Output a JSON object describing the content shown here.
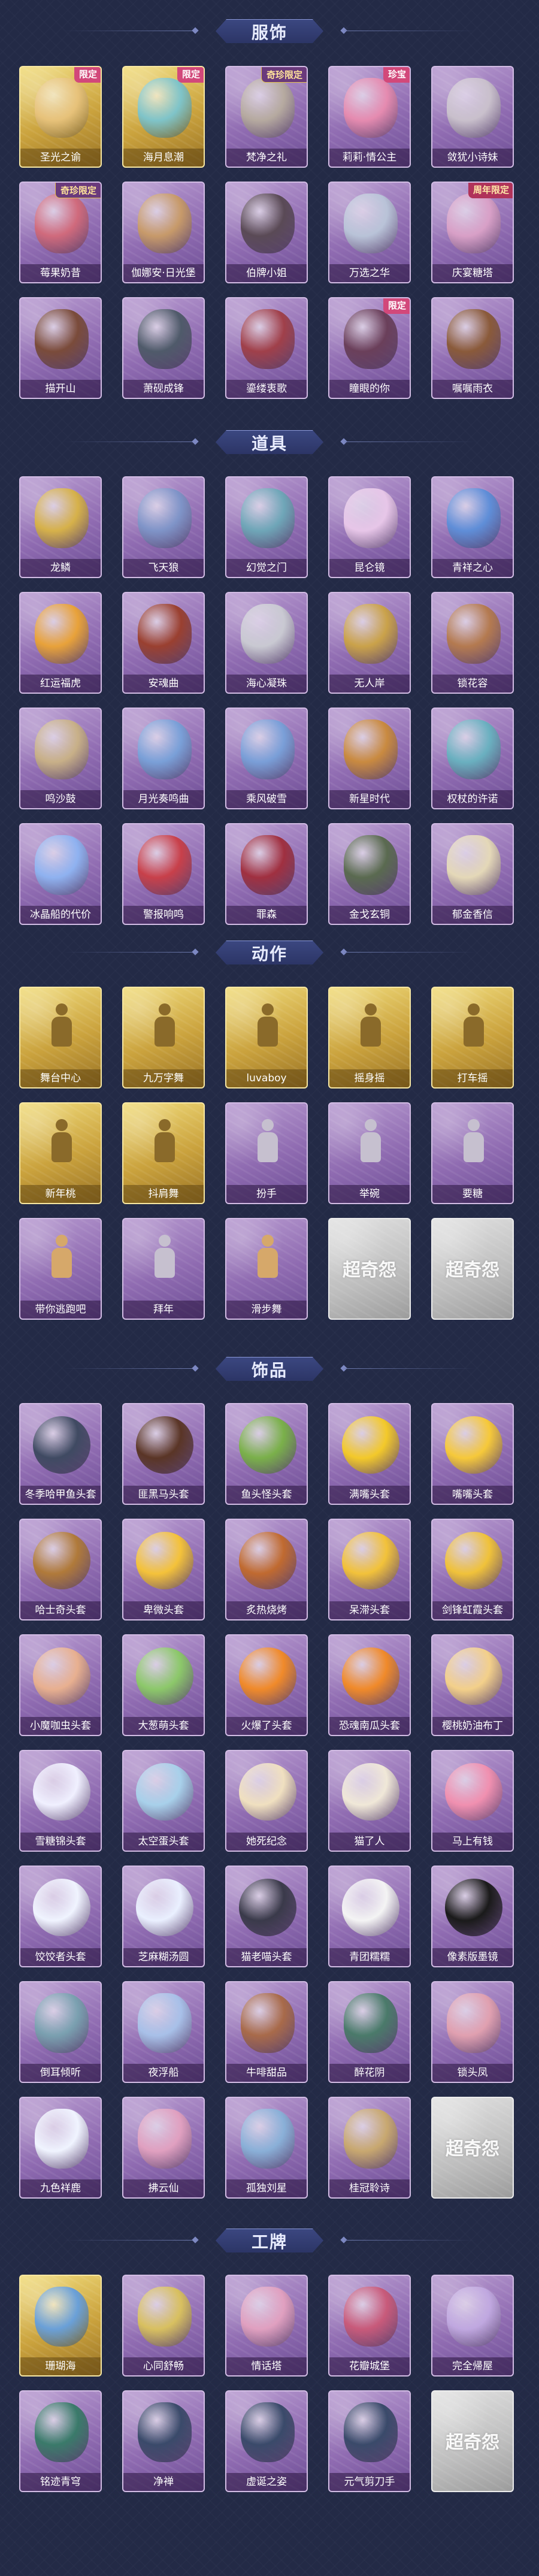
{
  "sections": [
    {
      "title": "服饰",
      "items": [
        {
          "label": "圣光之谕",
          "tag": "限定",
          "tag_type": "limited",
          "style": "gold",
          "icon": "costume-portrait-icon",
          "color": "#e7c27a"
        },
        {
          "label": "海月息潮",
          "tag": "限定",
          "tag_type": "limited",
          "style": "gold",
          "icon": "costume-portrait-icon",
          "color": "#7fc4c9"
        },
        {
          "label": "梵净之礼",
          "tag": "奇珍限定",
          "tag_type": "mystery",
          "style": "purple",
          "icon": "costume-portrait-icon",
          "color": "#b6aaa0"
        },
        {
          "label": "莉莉·情公主",
          "tag": "珍宝",
          "tag_type": "limited",
          "style": "purple",
          "icon": "costume-portrait-icon",
          "color": "#e58bb0"
        },
        {
          "label": "敛犹小诗妹",
          "tag": "",
          "tag_type": "",
          "style": "purple",
          "icon": "costume-portrait-icon",
          "color": "#c9c0cc"
        },
        {
          "label": "莓果奶昔",
          "tag": "奇珍限定",
          "tag_type": "mystery",
          "style": "purple",
          "icon": "costume-portrait-icon",
          "color": "#d06a7c"
        },
        {
          "label": "伽娜安·日光堡",
          "tag": "",
          "tag_type": "",
          "style": "purple",
          "icon": "costume-portrait-icon",
          "color": "#c79a6a"
        },
        {
          "label": "伯牌小姐",
          "tag": "",
          "tag_type": "",
          "style": "purple",
          "icon": "costume-portrait-icon",
          "color": "#5a4a56"
        },
        {
          "label": "万选之华",
          "tag": "",
          "tag_type": "",
          "style": "purple",
          "icon": "costume-portrait-icon",
          "color": "#b9c3d8"
        },
        {
          "label": "庆宴糖塔",
          "tag": "周年限定",
          "tag_type": "anniv",
          "style": "purple",
          "icon": "costume-portrait-icon",
          "color": "#d8a0c7"
        },
        {
          "label": "描开山",
          "tag": "",
          "tag_type": "",
          "style": "purple",
          "icon": "costume-portrait-icon",
          "color": "#7a4b3a"
        },
        {
          "label": "萧砚成锋",
          "tag": "",
          "tag_type": "",
          "style": "purple",
          "icon": "costume-portrait-icon",
          "color": "#4f5a6a"
        },
        {
          "label": "鎏缕衷歌",
          "tag": "",
          "tag_type": "",
          "style": "purple",
          "icon": "costume-portrait-icon",
          "color": "#a0404a"
        },
        {
          "label": "瞳眼的你",
          "tag": "限定",
          "tag_type": "limited",
          "style": "purple",
          "icon": "costume-portrait-icon",
          "color": "#6a3f5a"
        },
        {
          "label": "嘱嘱雨衣",
          "tag": "",
          "tag_type": "",
          "style": "purple",
          "icon": "costume-portrait-icon",
          "color": "#8a5a3a"
        }
      ]
    },
    {
      "title": "道具",
      "items": [
        {
          "label": "龙鳞",
          "style": "purple",
          "icon": "key-icon",
          "color": "#d6b14a"
        },
        {
          "label": "飞天狼",
          "style": "purple",
          "icon": "whip-icon",
          "color": "#7f94c8"
        },
        {
          "label": "幻觉之门",
          "style": "purple",
          "icon": "device-icon",
          "color": "#6fa6b8"
        },
        {
          "label": "昆仑镜",
          "style": "purple",
          "icon": "mirror-icon",
          "color": "#e7c6e8"
        },
        {
          "label": "青祥之心",
          "style": "purple",
          "icon": "pendant-icon",
          "color": "#5f8ed8"
        },
        {
          "label": "红运福虎",
          "style": "purple",
          "icon": "tiger-icon",
          "color": "#e8a23a"
        },
        {
          "label": "安魂曲",
          "style": "purple",
          "icon": "crossbow-icon",
          "color": "#9a4030"
        },
        {
          "label": "海心凝珠",
          "style": "purple",
          "icon": "shell-icon",
          "color": "#c9c9d2"
        },
        {
          "label": "无人岸",
          "style": "purple",
          "icon": "bottle-icon",
          "color": "#caa24a"
        },
        {
          "label": "锁花容",
          "style": "purple",
          "icon": "chain-icon",
          "color": "#b47a50"
        },
        {
          "label": "鸣沙鼓",
          "style": "purple",
          "icon": "drum-icon",
          "color": "#c8b088"
        },
        {
          "label": "月光奏鸣曲",
          "style": "purple",
          "icon": "music-box-icon",
          "color": "#7aa0d8"
        },
        {
          "label": "乘风破雪",
          "style": "purple",
          "icon": "skates-icon",
          "color": "#7a9fd8"
        },
        {
          "label": "新星时代",
          "style": "purple",
          "icon": "revolver-icon",
          "color": "#c98a40"
        },
        {
          "label": "权杖的许诺",
          "style": "purple",
          "icon": "scepter-icon",
          "color": "#6ab0c0"
        },
        {
          "label": "冰晶船的代价",
          "style": "purple",
          "icon": "crystal-flower-icon",
          "color": "#8fb2f0"
        },
        {
          "label": "警报响鸣",
          "style": "purple",
          "icon": "medkit-icon",
          "color": "#c8404a"
        },
        {
          "label": "罪森",
          "style": "purple",
          "icon": "staff-icon",
          "color": "#a03040"
        },
        {
          "label": "金戈玄铜",
          "style": "purple",
          "icon": "lantern-icon",
          "color": "#5a6a50"
        },
        {
          "label": "郁金香信",
          "style": "purple",
          "icon": "fan-icon",
          "color": "#e4d8b8"
        }
      ]
    },
    {
      "title": "动作",
      "items": [
        {
          "label": "舞台中心",
          "style": "gold",
          "icon": "pose-icon",
          "color": "#8a6a2a"
        },
        {
          "label": "九万字舞",
          "style": "gold",
          "icon": "pose-icon",
          "color": "#8a6a2a"
        },
        {
          "label": "luvaboy",
          "style": "gold",
          "icon": "pose-icon",
          "color": "#8a6a2a"
        },
        {
          "label": "摇身摇",
          "style": "gold",
          "icon": "pose-icon",
          "color": "#8a6a2a"
        },
        {
          "label": "打车摇",
          "style": "gold",
          "icon": "pose-icon",
          "color": "#8a6a2a"
        },
        {
          "label": "新年桃",
          "style": "gold",
          "icon": "pose-icon",
          "color": "#8a6a2a"
        },
        {
          "label": "抖肩舞",
          "style": "gold",
          "icon": "pose-icon",
          "color": "#8a6a2a"
        },
        {
          "label": "扮手",
          "style": "purple",
          "icon": "pose-icon",
          "color": "#c6c0cf"
        },
        {
          "label": "举碗",
          "style": "purple",
          "icon": "pose-icon",
          "color": "#c6c0cf"
        },
        {
          "label": "要糖",
          "style": "purple",
          "icon": "pose-icon",
          "color": "#c6c0cf"
        },
        {
          "label": "带你逃跑吧",
          "style": "purple",
          "icon": "pose-icon",
          "color": "#d6a86a"
        },
        {
          "label": "拜年",
          "style": "purple",
          "icon": "pose-icon",
          "color": "#c6c0cf"
        },
        {
          "label": "滑步舞",
          "style": "purple",
          "icon": "pose-icon",
          "color": "#d6a86a"
        },
        {
          "label": "",
          "style": "grey",
          "icon": "placeholder-logo-icon",
          "color": "#ffffff",
          "placeholder": "超奇怨"
        },
        {
          "label": "",
          "style": "grey",
          "icon": "placeholder-logo-icon",
          "color": "#ffffff",
          "placeholder": "超奇怨"
        }
      ]
    },
    {
      "title": "饰品",
      "items": [
        {
          "label": "冬季哈甲鱼头套",
          "style": "purple",
          "icon": "seal-mask-icon",
          "color": "#3f4a62"
        },
        {
          "label": "匪黑马头套",
          "style": "purple",
          "icon": "horse-mask-icon",
          "color": "#5a3526"
        },
        {
          "label": "鱼头怪头套",
          "style": "purple",
          "icon": "fish-mask-icon",
          "color": "#7ab04a"
        },
        {
          "label": "满嘴头套",
          "style": "purple",
          "icon": "smile-mask-icon",
          "color": "#f3c92a"
        },
        {
          "label": "嘴嘴头套",
          "style": "purple",
          "icon": "grin-mask-icon",
          "color": "#f6c93a"
        },
        {
          "label": "哈士奇头套",
          "style": "purple",
          "icon": "dog-mask-icon",
          "color": "#b07a3a"
        },
        {
          "label": "卑微头套",
          "style": "purple",
          "icon": "sad-mask-icon",
          "color": "#f4c23a"
        },
        {
          "label": "炙热烧烤",
          "style": "purple",
          "icon": "bbq-mask-icon",
          "color": "#c06a30"
        },
        {
          "label": "呆滞头套",
          "style": "purple",
          "icon": "dizzy-mask-icon",
          "color": "#f2c23a"
        },
        {
          "label": "剑锋虹霞头套",
          "style": "purple",
          "icon": "pikachu-mask-icon",
          "color": "#f0c23a"
        },
        {
          "label": "小魔咖虫头套",
          "style": "purple",
          "icon": "bug-mask-icon",
          "color": "#e8b090"
        },
        {
          "label": "大葱萌头套",
          "style": "purple",
          "icon": "onion-mask-icon",
          "color": "#8cc86a"
        },
        {
          "label": "火爆了头套",
          "style": "purple",
          "icon": "fire-mask-icon",
          "color": "#f08a2a"
        },
        {
          "label": "恐魂南瓜头套",
          "style": "purple",
          "icon": "pumpkin-mask-icon",
          "color": "#f08a2a"
        },
        {
          "label": "樱桃奶油布丁",
          "style": "purple",
          "icon": "pudding-mask-icon",
          "color": "#f3d08a"
        },
        {
          "label": "雪糖锦头套",
          "style": "purple",
          "icon": "snow-mask-icon",
          "color": "#f0f0ff"
        },
        {
          "label": "太空蛋头套",
          "style": "purple",
          "icon": "egg-mask-icon",
          "color": "#a8d0ea"
        },
        {
          "label": "她死纪念",
          "style": "purple",
          "icon": "ghost-mask-icon",
          "color": "#f0e0c0"
        },
        {
          "label": "猫了人",
          "style": "purple",
          "icon": "radish-mask-icon",
          "color": "#f0e8d8"
        },
        {
          "label": "马上有钱",
          "style": "purple",
          "icon": "piggy-mask-icon",
          "color": "#f090b0"
        },
        {
          "label": "饺饺者头套",
          "style": "purple",
          "icon": "cloud-mask-icon",
          "color": "#f0f4ff"
        },
        {
          "label": "芝麻糊汤圆",
          "style": "purple",
          "icon": "dumpling-mask-icon",
          "color": "#eaf0ff"
        },
        {
          "label": "猫老喵头套",
          "style": "purple",
          "icon": "cat-mask-icon",
          "color": "#3a3a4a"
        },
        {
          "label": "青团糯糯",
          "style": "purple",
          "icon": "rice-mask-icon",
          "color": "#f4f4f4"
        },
        {
          "label": "像素版墨镜",
          "style": "purple",
          "icon": "sunglasses-icon",
          "color": "#1a1a1a"
        },
        {
          "label": "倒耳倾听",
          "style": "purple",
          "icon": "headdress-icon",
          "color": "#7aa0b0"
        },
        {
          "label": "夜浮船",
          "style": "purple",
          "icon": "ornament-icon",
          "color": "#a8c0e8"
        },
        {
          "label": "牛啡甜品",
          "style": "purple",
          "icon": "cake-icon",
          "color": "#a86a4a"
        },
        {
          "label": "醉花阴",
          "style": "purple",
          "icon": "flower-ornament-icon",
          "color": "#4a7a6a"
        },
        {
          "label": "锁头凤",
          "style": "purple",
          "icon": "phoenix-ornament-icon",
          "color": "#e0a0b0"
        },
        {
          "label": "九色祥鹿",
          "style": "purple",
          "icon": "deer-icon",
          "color": "#f0f4ff"
        },
        {
          "label": "拂云仙",
          "style": "purple",
          "icon": "charm-icon",
          "color": "#e0a0c0"
        },
        {
          "label": "孤独刘星",
          "style": "purple",
          "icon": "lantern-charm-icon",
          "color": "#8ab0d8"
        },
        {
          "label": "桂冠聆诗",
          "style": "purple",
          "icon": "wreath-charm-icon",
          "color": "#c8a870"
        },
        {
          "label": "",
          "style": "grey",
          "icon": "placeholder-logo-icon",
          "color": "#ffffff",
          "placeholder": "超奇怨"
        }
      ]
    },
    {
      "title": "工牌",
      "items": [
        {
          "label": "珊瑚海",
          "style": "gold",
          "icon": "badge-card-icon",
          "color": "#6aa0d8"
        },
        {
          "label": "心同舒畅",
          "style": "purple",
          "icon": "badge-card-icon",
          "color": "#d8c060"
        },
        {
          "label": "情话塔",
          "style": "purple",
          "icon": "badge-card-icon",
          "color": "#e0a0c0"
        },
        {
          "label": "花瓣城堡",
          "style": "purple",
          "icon": "badge-card-icon",
          "color": "#c85a7a"
        },
        {
          "label": "完全帰屋",
          "style": "purple",
          "icon": "badge-card-icon",
          "color": "#c0a8e0"
        },
        {
          "label": "铭迹青穹",
          "style": "purple",
          "icon": "badge-card-icon",
          "color": "#3a7a6a"
        },
        {
          "label": "净禅",
          "style": "purple",
          "icon": "badge-card-icon",
          "color": "#3a4a6a"
        },
        {
          "label": "虚诞之姿",
          "style": "purple",
          "icon": "badge-card-icon",
          "color": "#3a4a6a"
        },
        {
          "label": "元气剪刀手",
          "style": "purple",
          "icon": "badge-card-icon",
          "color": "#3a4a6a"
        },
        {
          "label": "",
          "style": "grey",
          "icon": "placeholder-logo-icon",
          "color": "#ffffff",
          "placeholder": "超奇怨"
        }
      ]
    }
  ]
}
